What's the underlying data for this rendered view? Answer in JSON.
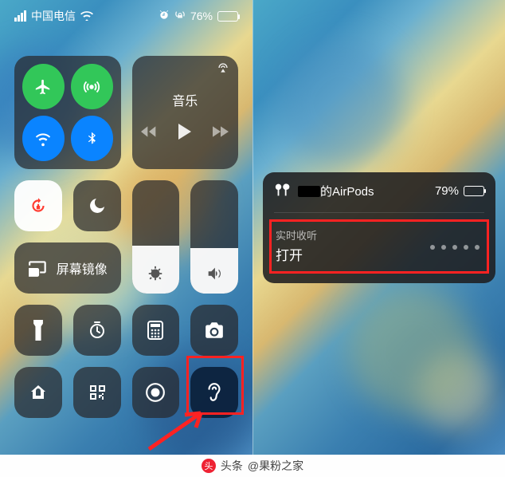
{
  "status_bar": {
    "carrier": "中国电信",
    "battery_pct_text": "76%",
    "battery_pct": 76
  },
  "connectivity": {
    "airplane": {
      "active": true
    },
    "cellular": {
      "active": true
    },
    "wifi": {
      "active": true
    },
    "bluetooth": {
      "active": true
    }
  },
  "music": {
    "title": "音乐"
  },
  "orientation_lock": {
    "active": true
  },
  "do_not_disturb": {
    "active": false
  },
  "brightness": {
    "level_pct": 42
  },
  "volume": {
    "level_pct": 40
  },
  "screen_mirror": {
    "label": "屏幕镜像"
  },
  "small_tiles": {
    "flashlight": "flashlight",
    "timer": "timer",
    "calculator": "calculator",
    "camera": "camera",
    "home": "home",
    "qrcode": "qr-scan",
    "screen_record": "screen-record",
    "hearing": "hearing"
  },
  "airpods_popup": {
    "device_name_suffix": "的AirPods",
    "battery_pct_text": "79%",
    "battery_pct": 79,
    "live_listen_label": "实时收听",
    "live_listen_value": "打开",
    "dot_count": 5
  },
  "watermark": {
    "prefix": "头条",
    "account": "@果粉之家"
  }
}
